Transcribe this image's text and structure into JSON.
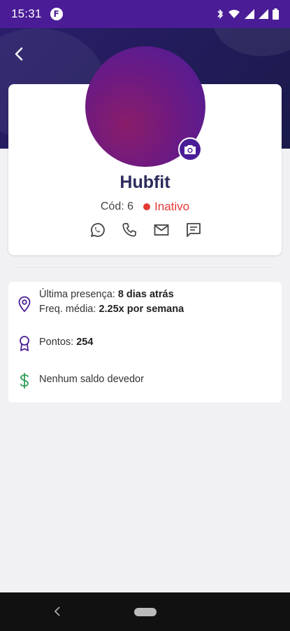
{
  "status_bar": {
    "time": "15:31",
    "app_icon_letter": "F"
  },
  "profile": {
    "name": "Hubfit",
    "code": "Cód: 6",
    "status": "Inativo",
    "status_color": "#e53935",
    "accent_color": "#4a1d96",
    "contacts": [
      {
        "icon": "whatsapp-icon"
      },
      {
        "icon": "phone-icon"
      },
      {
        "icon": "mail-icon"
      },
      {
        "icon": "message-icon"
      }
    ]
  },
  "info": {
    "last_presence_label": "Última presença:",
    "last_presence_value": "8 dias atrás",
    "freq_label": "Freq. média:",
    "freq_value": "2.25x por semana",
    "points_label": "Pontos:",
    "points_value": "254",
    "balance_text": "Nenhum saldo devedor",
    "balance_color": "#2e9e57"
  }
}
